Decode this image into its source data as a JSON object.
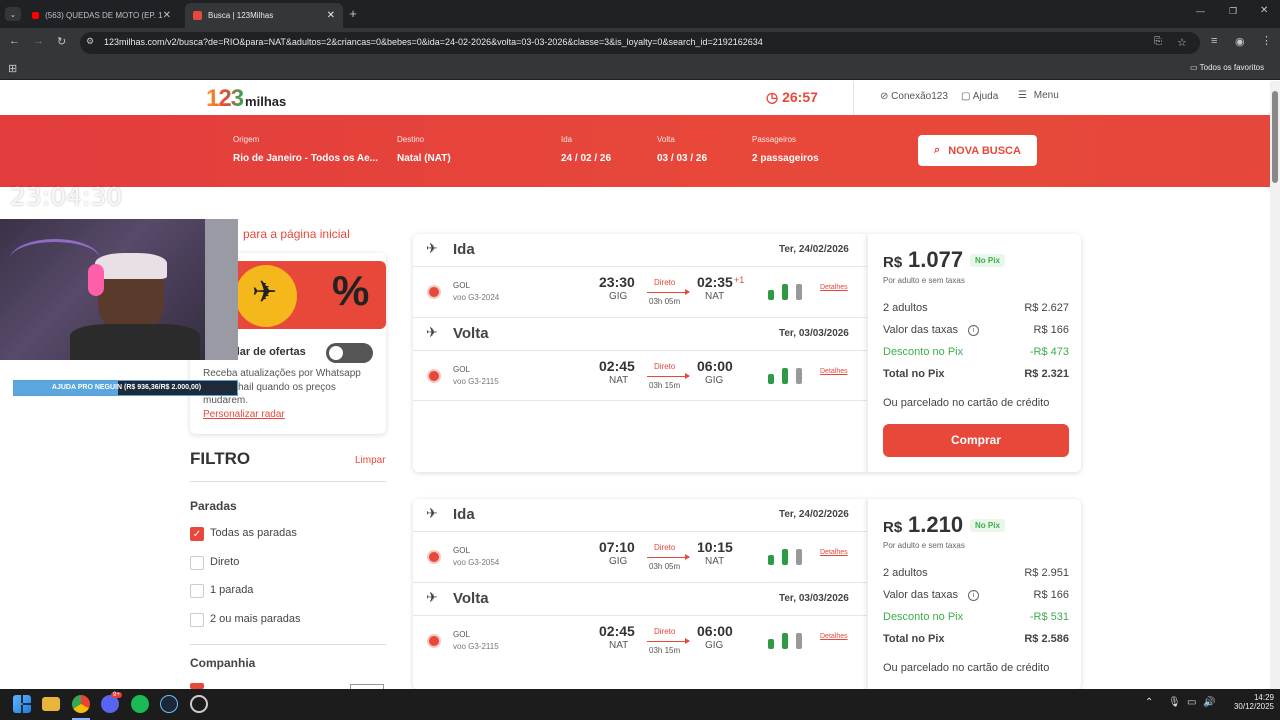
{
  "browser": {
    "tabs": [
      {
        "title": "(563) QUEDAS DE MOTO (EP. 1"
      },
      {
        "title": "Busca | 123Milhas"
      }
    ],
    "url": "123milhas.com/v2/busca?de=RIO&para=NAT&adultos=2&criancas=0&bebes=0&ida=24-02-2026&volta=03-03-2026&classe=3&is_loyalty=0&search_id=2192162634",
    "bookmarks_folder": "Todos os favoritos"
  },
  "header": {
    "logo_num": "123",
    "logo_text": "milhas",
    "timer": "26:57",
    "conexao": "Conexão123",
    "ajuda": "Ajuda",
    "menu": "Menu"
  },
  "search": {
    "origem_label": "Origem",
    "origem": "Rio de Janeiro - Todos os Ae...",
    "destino_label": "Destino",
    "destino": "Natal (NAT)",
    "ida_label": "Ida",
    "ida": "24 / 02 / 26",
    "volta_label": "Volta",
    "volta": "03 / 03 / 26",
    "pass_label": "Passageiros",
    "pass": "2 passageiros",
    "button": "NOVA BUSCA"
  },
  "overlay": {
    "clock": "23:04:30",
    "donation": "AJUDA PRO NEGUIN (R$ 936,36/R$ 2.000,00)",
    "donation_progress": 0.468
  },
  "sidebar": {
    "back_link": "para a página inicial",
    "radar_title": "dar de ofertas",
    "radar_text1": "Receba atualizações por Whatsapp",
    "radar_text2": "hail quando os preços",
    "radar_text3": "mudarem.",
    "radar_link": "Personalizar radar",
    "filtro": "FILTRO",
    "limpar": "Limpar",
    "paradas": "Paradas",
    "options": [
      {
        "label": "Todas as paradas",
        "checked": true
      },
      {
        "label": "Direto",
        "checked": false
      },
      {
        "label": "1 parada",
        "checked": false
      },
      {
        "label": "2 ou mais paradas",
        "checked": false
      }
    ],
    "companhia": "Companhia"
  },
  "results": [
    {
      "legs": [
        {
          "title": "Ida",
          "date": "Ter, 24/02/2026",
          "airline": "GOL",
          "flight": "voo G3-2024",
          "dep": "23:30",
          "dep_apt": "GIG",
          "arr": "02:35",
          "plus": "+1",
          "arr_apt": "NAT",
          "direto": "Direto",
          "dur": "03h 05m",
          "detalhes": "Detalhes"
        },
        {
          "title": "Volta",
          "date": "Ter, 03/03/2026",
          "airline": "GOL",
          "flight": "voo G3-2115",
          "dep": "02:45",
          "dep_apt": "NAT",
          "arr": "06:00",
          "plus": "",
          "arr_apt": "GIG",
          "direto": "Direto",
          "dur": "03h 15m",
          "detalhes": "Detalhes"
        }
      ],
      "price": {
        "currency": "R$",
        "value": "1.077",
        "pix_badge": "No Pix",
        "sub": "Por adulto e sem taxas",
        "adults_label": "2 adultos",
        "adults_value": "R$ 2.627",
        "taxes_label": "Valor das taxas",
        "taxes_value": "R$ 166",
        "discount_label": "Desconto no Pix",
        "discount_value": "-R$ 473",
        "total_label": "Total no Pix",
        "total_value": "R$ 2.321",
        "installments": "Ou parcelado no cartão de crédito",
        "buy": "Comprar"
      }
    },
    {
      "legs": [
        {
          "title": "Ida",
          "date": "Ter, 24/02/2026",
          "airline": "GOL",
          "flight": "voo G3-2054",
          "dep": "07:10",
          "dep_apt": "GIG",
          "arr": "10:15",
          "plus": "",
          "arr_apt": "NAT",
          "direto": "Direto",
          "dur": "03h 05m",
          "detalhes": "Detalhes"
        },
        {
          "title": "Volta",
          "date": "Ter, 03/03/2026",
          "airline": "GOL",
          "flight": "voo G3-2115",
          "dep": "02:45",
          "dep_apt": "NAT",
          "arr": "06:00",
          "plus": "",
          "arr_apt": "GIG",
          "direto": "Direto",
          "dur": "03h 15m",
          "detalhes": "Detalhes"
        }
      ],
      "price": {
        "currency": "R$",
        "value": "1.210",
        "pix_badge": "No Pix",
        "sub": "Por adulto e sem taxas",
        "adults_label": "2 adultos",
        "adults_value": "R$ 2.951",
        "taxes_label": "Valor das taxas",
        "taxes_value": "R$ 166",
        "discount_label": "Desconto no Pix",
        "discount_value": "-R$ 531",
        "total_label": "Total no Pix",
        "total_value": "R$ 2.586",
        "installments": "Ou parcelado no cartão de crédito",
        "buy": "Comprar"
      }
    }
  ],
  "taskbar": {
    "time": "14:29",
    "date": "30/12/2025",
    "discord_badge": "9+"
  }
}
